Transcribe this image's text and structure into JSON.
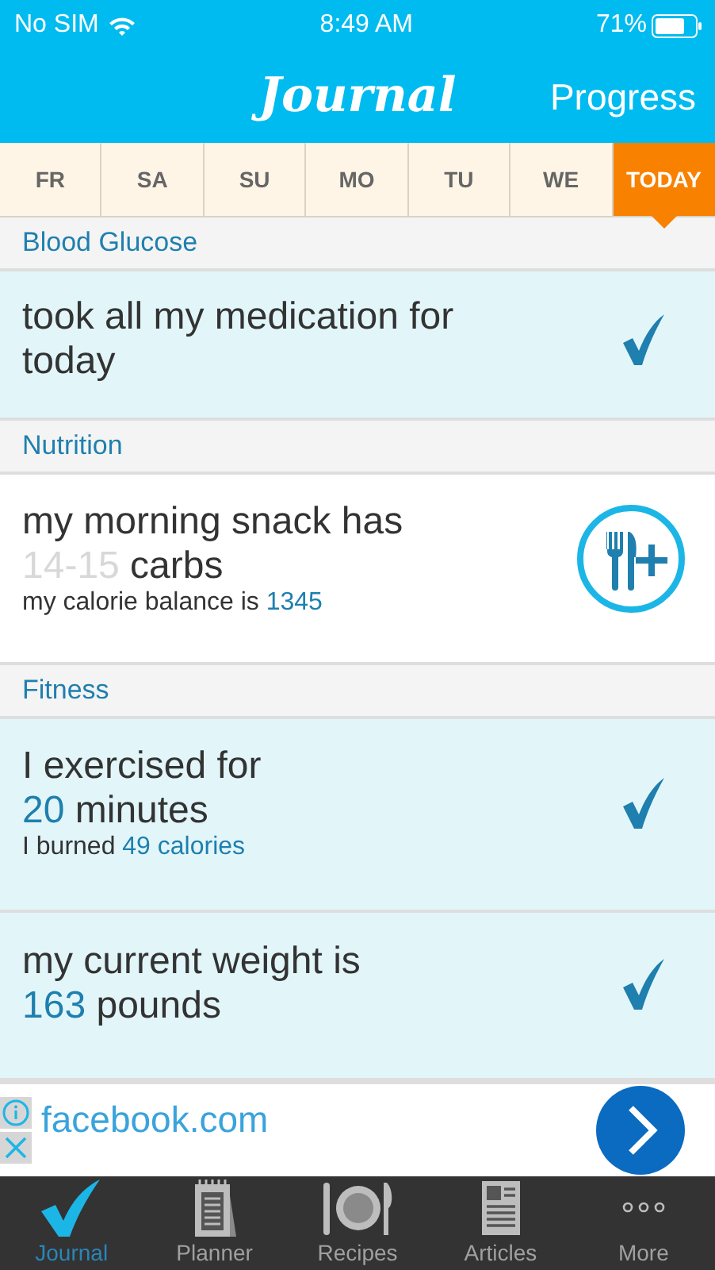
{
  "status_bar": {
    "carrier": "No SIM",
    "time": "8:49 AM",
    "battery": "71%"
  },
  "header": {
    "title": "Journal",
    "action": "Progress"
  },
  "days": [
    {
      "label": "FR",
      "selected": false
    },
    {
      "label": "SA",
      "selected": false
    },
    {
      "label": "SU",
      "selected": false
    },
    {
      "label": "MO",
      "selected": false
    },
    {
      "label": "TU",
      "selected": false
    },
    {
      "label": "WE",
      "selected": false
    },
    {
      "label": "TODAY",
      "selected": true
    }
  ],
  "sections": [
    {
      "title": "Blood Glucose",
      "entries": [
        {
          "kind": "check",
          "checked": true,
          "title": [
            [
              {
                "text": "took all my medication for"
              }
            ],
            [
              {
                "text": "today"
              }
            ]
          ]
        }
      ]
    },
    {
      "title": "Nutrition",
      "entries": [
        {
          "kind": "add",
          "title": [
            [
              {
                "text": "my morning snack has"
              }
            ],
            [
              {
                "text": "14-15",
                "color": "#d8d8d8"
              },
              {
                "text": " carbs"
              }
            ]
          ],
          "note": [
            {
              "text": "my calorie balance is "
            },
            {
              "text": "1345",
              "color": "#1f7fae"
            }
          ]
        }
      ]
    },
    {
      "title": "Fitness",
      "entries": [
        {
          "kind": "check",
          "checked": true,
          "title": [
            [
              {
                "text": "I exercised for"
              }
            ],
            [
              {
                "text": "20",
                "color": "#1f7fae"
              },
              {
                "text": " minutes"
              }
            ]
          ],
          "note": [
            {
              "text": "I burned "
            },
            {
              "text": "49 calories",
              "color": "#1f7fae"
            }
          ]
        },
        {
          "kind": "check",
          "checked": true,
          "title": [
            [
              {
                "text": "my current weight is"
              }
            ],
            [
              {
                "text": "163",
                "color": "#1f7fae"
              },
              {
                "text": " pounds"
              }
            ]
          ]
        }
      ]
    }
  ],
  "ad": {
    "text": "facebook.com"
  },
  "tabs": [
    {
      "label": "Journal",
      "selected": true
    },
    {
      "label": "Planner",
      "selected": false
    },
    {
      "label": "Recipes",
      "selected": false
    },
    {
      "label": "Articles",
      "selected": false
    },
    {
      "label": "More",
      "selected": false
    }
  ]
}
